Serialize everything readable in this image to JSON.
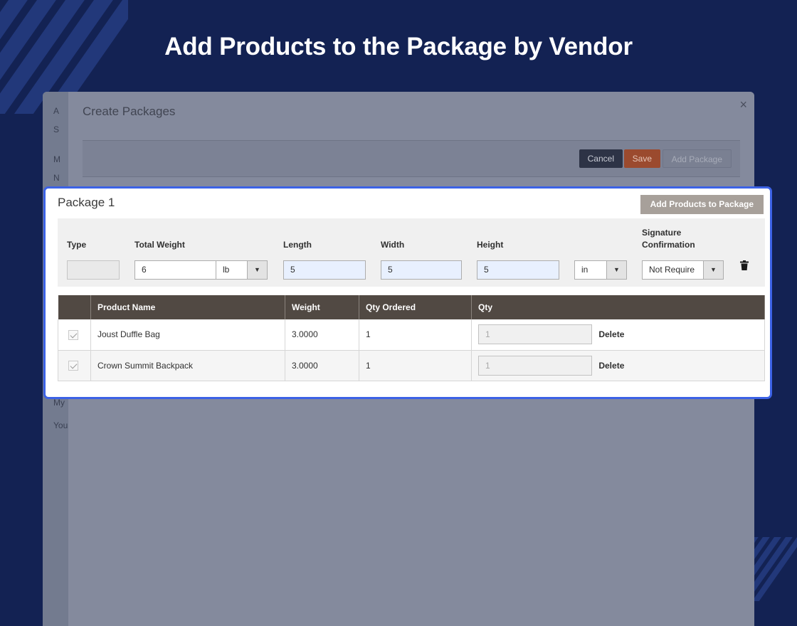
{
  "hero": {
    "title": "Add Products to the Package by Vendor"
  },
  "background_modal": {
    "title": "Create Packages",
    "close_glyph": "×",
    "cancel_label": "Cancel",
    "save_label": "Save",
    "add_package_label": "Add Package",
    "behind_fragments": [
      "A",
      "S",
      "M",
      "N",
      "My",
      "You"
    ]
  },
  "package": {
    "title": "Package 1",
    "add_products_label": "Add Products to Package",
    "fields": {
      "type_label": "Type",
      "type_value": "",
      "total_weight_label": "Total Weight",
      "total_weight_value": "6",
      "weight_unit": "lb",
      "length_label": "Length",
      "length_value": "5",
      "width_label": "Width",
      "width_value": "5",
      "height_label": "Height",
      "height_value": "5",
      "dimension_unit": "in",
      "signature_label_line1": "Signature",
      "signature_label_line2": "Confirmation",
      "signature_value": "Not Require"
    },
    "table": {
      "columns": [
        "Product Name",
        "Weight",
        "Qty Ordered",
        "Qty"
      ],
      "rows": [
        {
          "checked": true,
          "product_name": "Joust Duffle Bag",
          "weight": "3.0000",
          "qty_ordered": "1",
          "qty": "1",
          "delete_label": "Delete"
        },
        {
          "checked": true,
          "product_name": "Crown Summit Backpack",
          "weight": "3.0000",
          "qty_ordered": "1",
          "qty": "1",
          "delete_label": "Delete"
        }
      ]
    }
  },
  "colors": {
    "page_bg": "#132253",
    "highlight_border": "#3c62e6",
    "table_header": "#514943",
    "save_button": "#9b4a2e",
    "add_products_button": "#a7a09a"
  },
  "icons": [
    "trash-icon",
    "close-icon",
    "chevron-down-icon",
    "checkbox-checked-icon"
  ]
}
